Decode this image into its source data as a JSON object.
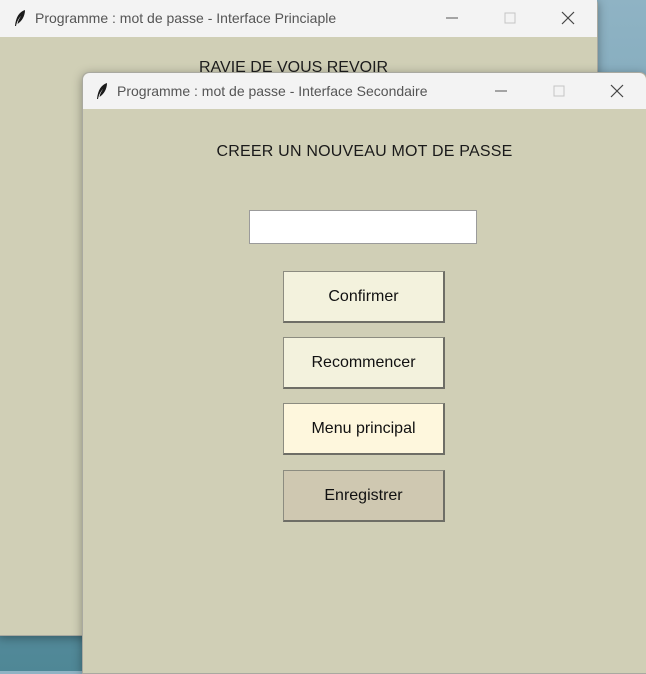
{
  "main_window": {
    "title": "Programme : mot de passe - Interface Princiaple",
    "heading": "RAVIE DE VOUS REVOIR"
  },
  "second_window": {
    "title": "Programme : mot de passe - Interface Secondaire",
    "heading": "CREER UN NOUVEAU MOT DE PASSE",
    "password_input": {
      "value": "",
      "placeholder": ""
    },
    "buttons": {
      "confirm": "Confirmer",
      "restart": "Recommencer",
      "main_menu": "Menu principal",
      "save": "Enregistrer"
    }
  },
  "icons": {
    "app": "feather-icon",
    "minimize": "minimize-icon",
    "maximize": "maximize-icon",
    "close": "close-icon"
  },
  "colors": {
    "window_bg": "#d0cfb6",
    "titlebar_bg": "#f3f3f3",
    "button_light": "#f3f2dd",
    "button_menu": "#fef7dd",
    "button_save": "#cfc8b1",
    "desktop": "#6a9aad"
  }
}
